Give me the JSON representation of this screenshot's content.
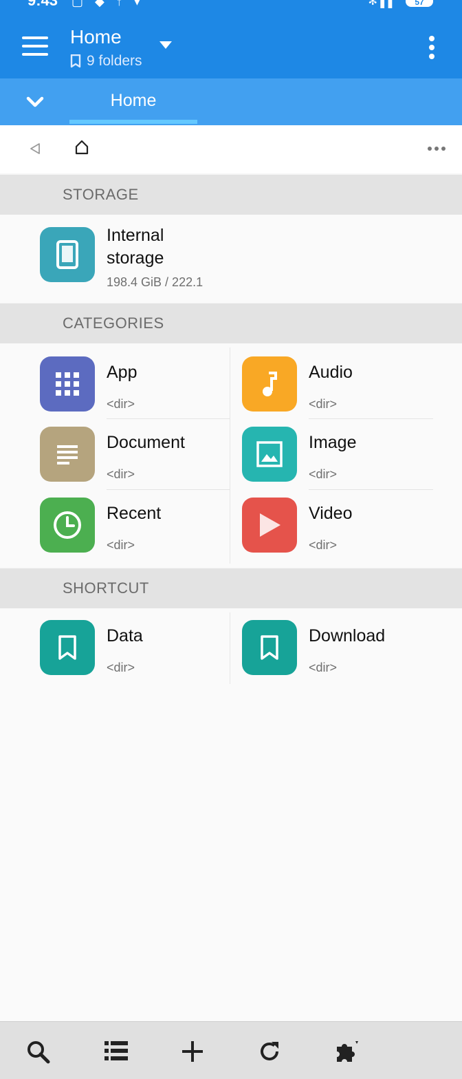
{
  "status_bar": {
    "time": "9:43",
    "battery": "57"
  },
  "app_bar": {
    "title": "Home",
    "subtitle": "9 folders"
  },
  "tab_bar": {
    "active_tab": "Home"
  },
  "sections": {
    "storage": {
      "header": "STORAGE",
      "items": [
        {
          "name": "Internal storage",
          "name_line1": "Internal",
          "name_line2": "storage",
          "detail": "198.4 GiB / 222.1",
          "icon": "tablet-icon",
          "color": "#3aa6b9"
        }
      ]
    },
    "categories": {
      "header": "CATEGORIES",
      "items": [
        {
          "name": "App",
          "detail": "<dir>",
          "icon": "grid-icon",
          "color": "#5c6bc0"
        },
        {
          "name": "Audio",
          "detail": "<dir>",
          "icon": "music-note-icon",
          "color": "#f9a825"
        },
        {
          "name": "Document",
          "detail": "<dir>",
          "icon": "document-icon",
          "color": "#b5a47e"
        },
        {
          "name": "Image",
          "detail": "<dir>",
          "icon": "image-icon",
          "color": "#26b5b0"
        },
        {
          "name": "Recent",
          "detail": "<dir>",
          "icon": "clock-icon",
          "color": "#4caf50"
        },
        {
          "name": "Video",
          "detail": "<dir>",
          "icon": "play-icon",
          "color": "#e5534b"
        }
      ]
    },
    "shortcut": {
      "header": "SHORTCUT",
      "items": [
        {
          "name": "Data",
          "detail": "<dir>",
          "icon": "bookmark-icon",
          "color": "#17a398"
        },
        {
          "name": "Download",
          "detail": "<dir>",
          "icon": "bookmark-icon",
          "color": "#17a398"
        }
      ]
    }
  },
  "bottom_bar": {
    "icons": [
      "search-icon",
      "list-icon",
      "add-icon",
      "refresh-icon",
      "extension-icon"
    ]
  }
}
